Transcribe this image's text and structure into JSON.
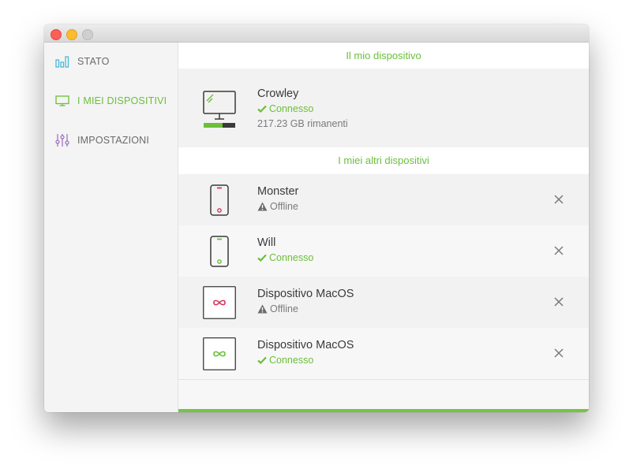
{
  "sidebar": {
    "items": [
      {
        "label": "STATO",
        "icon": "bar-chart-icon",
        "active": false
      },
      {
        "label": "I MIEI DISPOSITIVI",
        "icon": "monitor-icon",
        "active": true
      },
      {
        "label": "IMPOSTAZIONI",
        "icon": "sliders-icon",
        "active": false
      }
    ]
  },
  "main": {
    "my_device_title": "Il mio dispositivo",
    "my_device": {
      "name": "Crowley",
      "status": "Connesso",
      "storage": "217.23 GB rimanenti",
      "icon": "desktop-icon",
      "storage_used_fraction": 0.6
    },
    "other_devices_title": "I miei altri dispositivi",
    "other_devices": [
      {
        "name": "Monster",
        "status": "Offline",
        "online": false,
        "icon": "phone-icon"
      },
      {
        "name": "Will",
        "status": "Connesso",
        "online": true,
        "icon": "phone-icon"
      },
      {
        "name": "Dispositivo MacOS",
        "status": "Offline",
        "online": false,
        "icon": "infinity-icon"
      },
      {
        "name": "Dispositivo MacOS",
        "status": "Connesso",
        "online": true,
        "icon": "infinity-icon"
      }
    ]
  },
  "colors": {
    "accent": "#6bbf3a",
    "offline_accent": "#d9345a",
    "stato_icon": "#4db8d6",
    "impostazioni_icon": "#9b6bbf"
  }
}
